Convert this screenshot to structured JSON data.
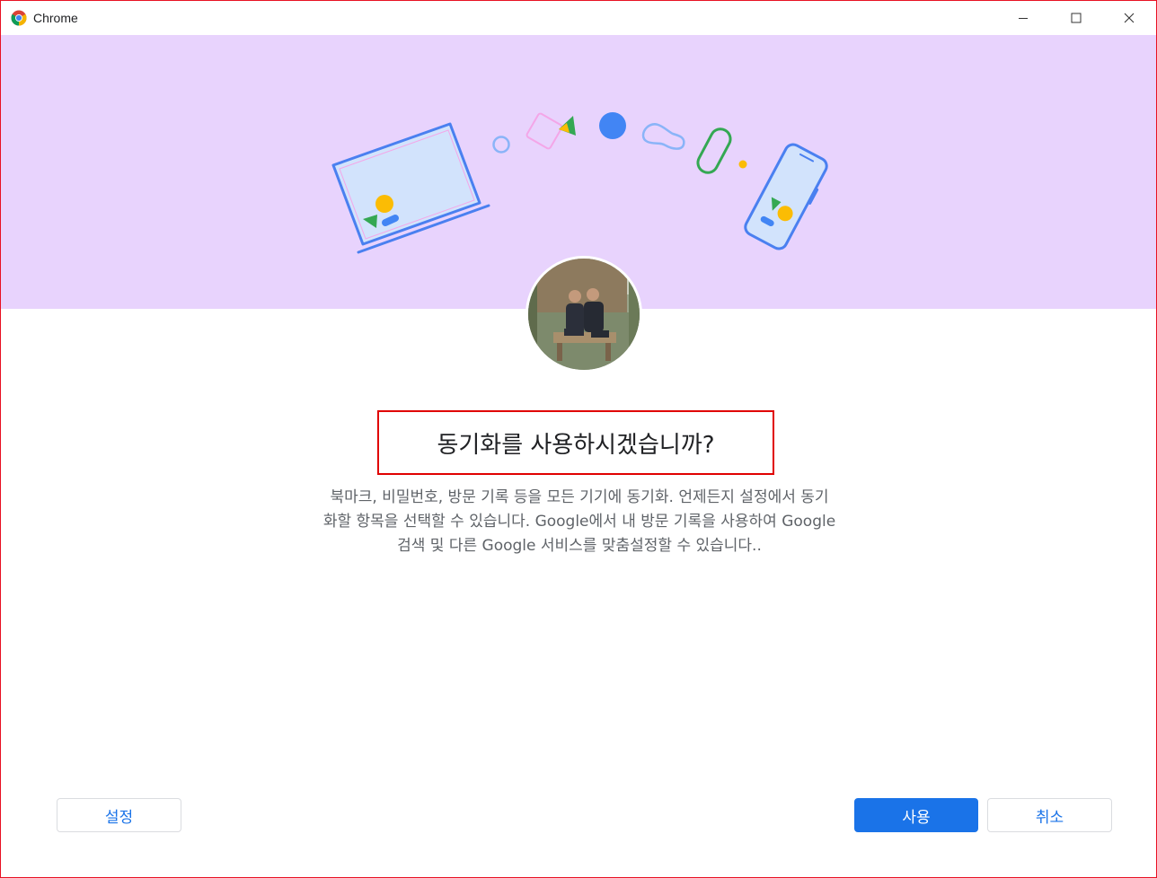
{
  "window": {
    "title": "Chrome",
    "controls": {
      "minimize": "minimize-icon",
      "maximize": "maximize-icon",
      "close": "close-icon"
    }
  },
  "banner": {
    "background": "#e8d3fd"
  },
  "dialog": {
    "title": "동기화를 사용하시겠습니까?",
    "description": [
      "북마크, 비밀번호, 방문 기록 등을 모든 기기에 동기화. 언제든지 설정에서 동기",
      "화할 항목을 선택할 수 있습니다. Google에서 내 방문 기록을 사용하여 Google",
      "검색 및 다른 Google 서비스를 맞춤설정할 수 있습니다.."
    ]
  },
  "buttons": {
    "settings": "설정",
    "use": "사용",
    "cancel": "취소"
  },
  "colors": {
    "accent": "#1a73e8",
    "highlight_border": "#e00000",
    "window_border": "#e81123"
  }
}
